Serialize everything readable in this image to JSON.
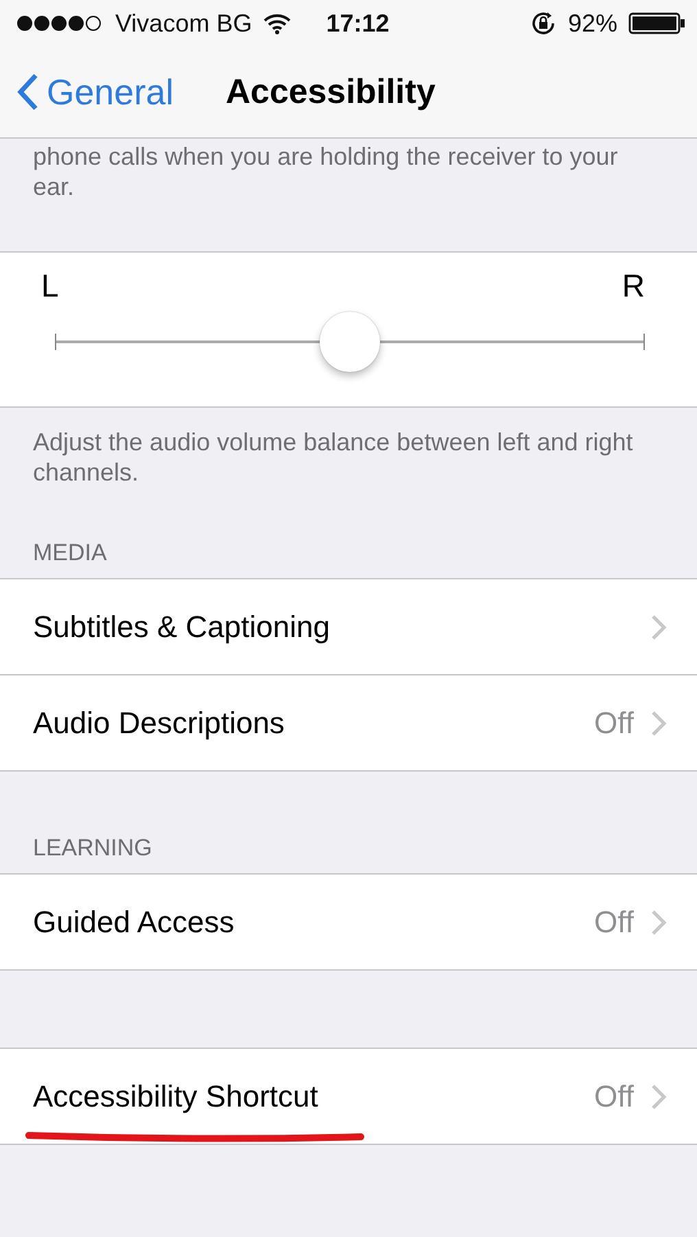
{
  "status_bar": {
    "carrier": "Vivacom BG",
    "time": "17:12",
    "battery": "92%"
  },
  "nav": {
    "back": "General",
    "title": "Accessibility"
  },
  "top_footer": "phone calls when you are holding the receiver to your ear.",
  "balance": {
    "left": "L",
    "right": "R",
    "level": 0.5,
    "footer": "Adjust the audio volume balance between left and right channels."
  },
  "sections": [
    {
      "header": "MEDIA",
      "rows": [
        {
          "label": "Subtitles & Captioning",
          "underlined": false
        },
        {
          "label": "Audio Descriptions",
          "value": "Off",
          "underlined": false
        }
      ]
    },
    {
      "header": "LEARNING",
      "rows": [
        {
          "label": "Guided Access",
          "value": "Off",
          "underlined": false
        }
      ]
    },
    {
      "rows": [
        {
          "label": "Accessibility Shortcut",
          "value": "Off",
          "underlined": true
        }
      ]
    }
  ]
}
